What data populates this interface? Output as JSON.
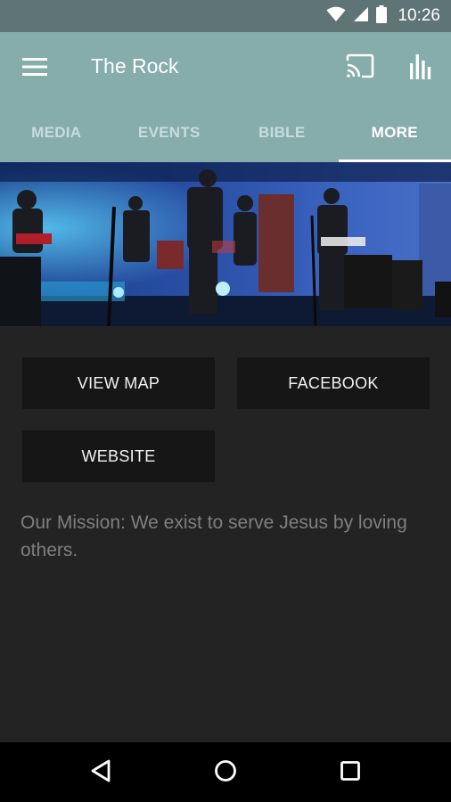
{
  "status_bar": {
    "time": "10:26",
    "icons": [
      "wifi-icon",
      "signal-icon",
      "battery-icon"
    ]
  },
  "app_bar": {
    "title": "The Rock",
    "icons": [
      "menu-icon",
      "cast-icon",
      "chart-icon"
    ]
  },
  "tabs": [
    {
      "label": "MEDIA",
      "active": false
    },
    {
      "label": "EVENTS",
      "active": false
    },
    {
      "label": "BIBLE",
      "active": false
    },
    {
      "label": "MORE",
      "active": true
    }
  ],
  "content": {
    "buttons": {
      "view_map": "VIEW MAP",
      "facebook": "FACEBOOK",
      "website": "WEBSITE"
    },
    "mission": "Our Mission: We exist to serve Jesus by loving others."
  },
  "nav_bar": {
    "icons": [
      "back-icon",
      "home-icon",
      "recents-icon"
    ]
  },
  "colors": {
    "status_bar": "#5f7474",
    "app_bar": "#86acac",
    "background": "#232323",
    "button": "#161616",
    "mission_text": "#7f7f7f"
  }
}
